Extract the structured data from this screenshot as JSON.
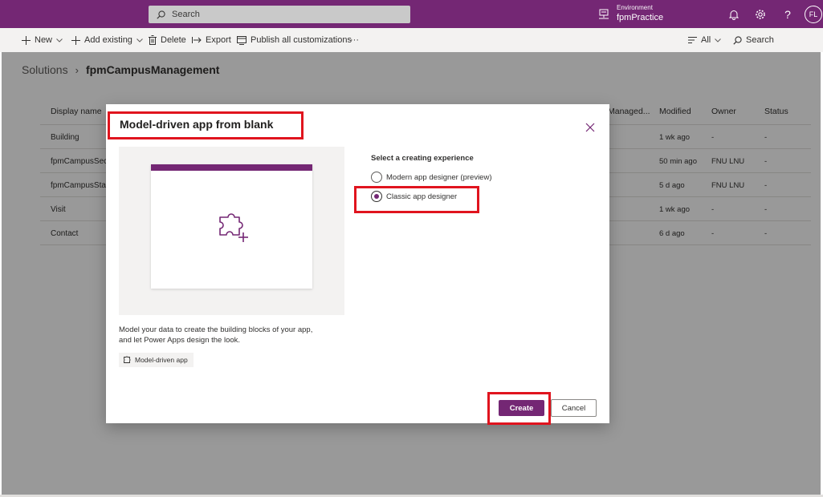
{
  "topbar": {
    "search_placeholder": "Search",
    "environment_label": "Environment",
    "environment_name": "fpmPractice",
    "user_initials": "FL",
    "icons": [
      "environment-icon",
      "bell-icon",
      "gear-icon",
      "help-icon"
    ]
  },
  "commandbar": {
    "new": "New",
    "add_existing": "Add existing",
    "delete": "Delete",
    "export": "Export",
    "publish": "Publish all customizations",
    "more": "···",
    "filter": "All",
    "search": "Search"
  },
  "breadcrumb": {
    "root": "Solutions",
    "current": "fpmCampusManagement"
  },
  "grid": {
    "columns": {
      "display_name": "Display name",
      "managed": "Managed...",
      "modified": "Modified",
      "owner": "Owner",
      "status": "Status"
    },
    "rows": [
      {
        "name": "Building",
        "modified": "1 wk ago",
        "owner": "-",
        "status": "-"
      },
      {
        "name": "fpmCampusSec",
        "modified": "50 min ago",
        "owner": "FNU LNU",
        "status": "-"
      },
      {
        "name": "fpmCampusStaf",
        "modified": "5 d ago",
        "owner": "FNU LNU",
        "status": "-"
      },
      {
        "name": "Visit",
        "modified": "1 wk ago",
        "owner": "-",
        "status": "-"
      },
      {
        "name": "Contact",
        "modified": "6 d ago",
        "owner": "-",
        "status": "-"
      }
    ]
  },
  "dialog": {
    "title": "Model-driven app from blank",
    "description": "Model your data to create the building blocks of your app, and let Power Apps design the look.",
    "tag": "Model-driven app",
    "section_label": "Select a creating experience",
    "options": [
      {
        "label": "Modern app designer (preview)",
        "selected": false
      },
      {
        "label": "Classic app designer",
        "selected": true
      }
    ],
    "create": "Create",
    "cancel": "Cancel"
  },
  "colors": {
    "brand": "#742774",
    "annotation": "#e0141e"
  }
}
